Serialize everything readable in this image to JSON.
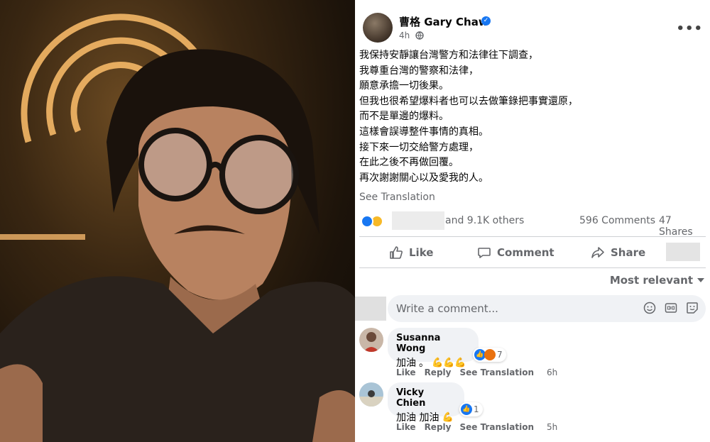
{
  "post": {
    "author": "曹格 Gary Chaw",
    "time": "4h",
    "more": "•••",
    "lines": [
      "我保持安靜讓台灣警方和法律往下調查，",
      "我尊重台灣的警察和法律，",
      "願意承擔一切後果。",
      "但我也很希望爆料者也可以去做筆錄把事實還原，",
      "而不是單邊的爆料。",
      "這樣會誤導整件事情的真相。",
      "接下來一切交給警方處理，",
      "在此之後不再做回覆。",
      "再次謝謝關心以及愛我的人。"
    ],
    "see_translation": "See Translation",
    "reaction_count": "and 9.1K others",
    "comments_count": "596 Comments",
    "shares_count": "47 Shares"
  },
  "actions": {
    "like": "Like",
    "comment": "Comment",
    "share": "Share"
  },
  "sort": {
    "label": "Most relevant"
  },
  "composer": {
    "placeholder": "Write a comment..."
  },
  "comments": [
    {
      "author": "Susanna Wong",
      "text": "加油",
      "reaction_count": "7",
      "like": "Like",
      "reply": "Reply",
      "see_translation": "See Translation",
      "time": "6h"
    },
    {
      "author": "Vicky Chien",
      "text": "加油 加油",
      "reaction_count": "1",
      "like": "Like",
      "reply": "Reply",
      "see_translation": "See Translation",
      "time": "5h"
    }
  ],
  "colors": {
    "facebook_blue": "#1877f2",
    "secondary_text": "#65676b",
    "bubble_bg": "#f0f2f5"
  }
}
